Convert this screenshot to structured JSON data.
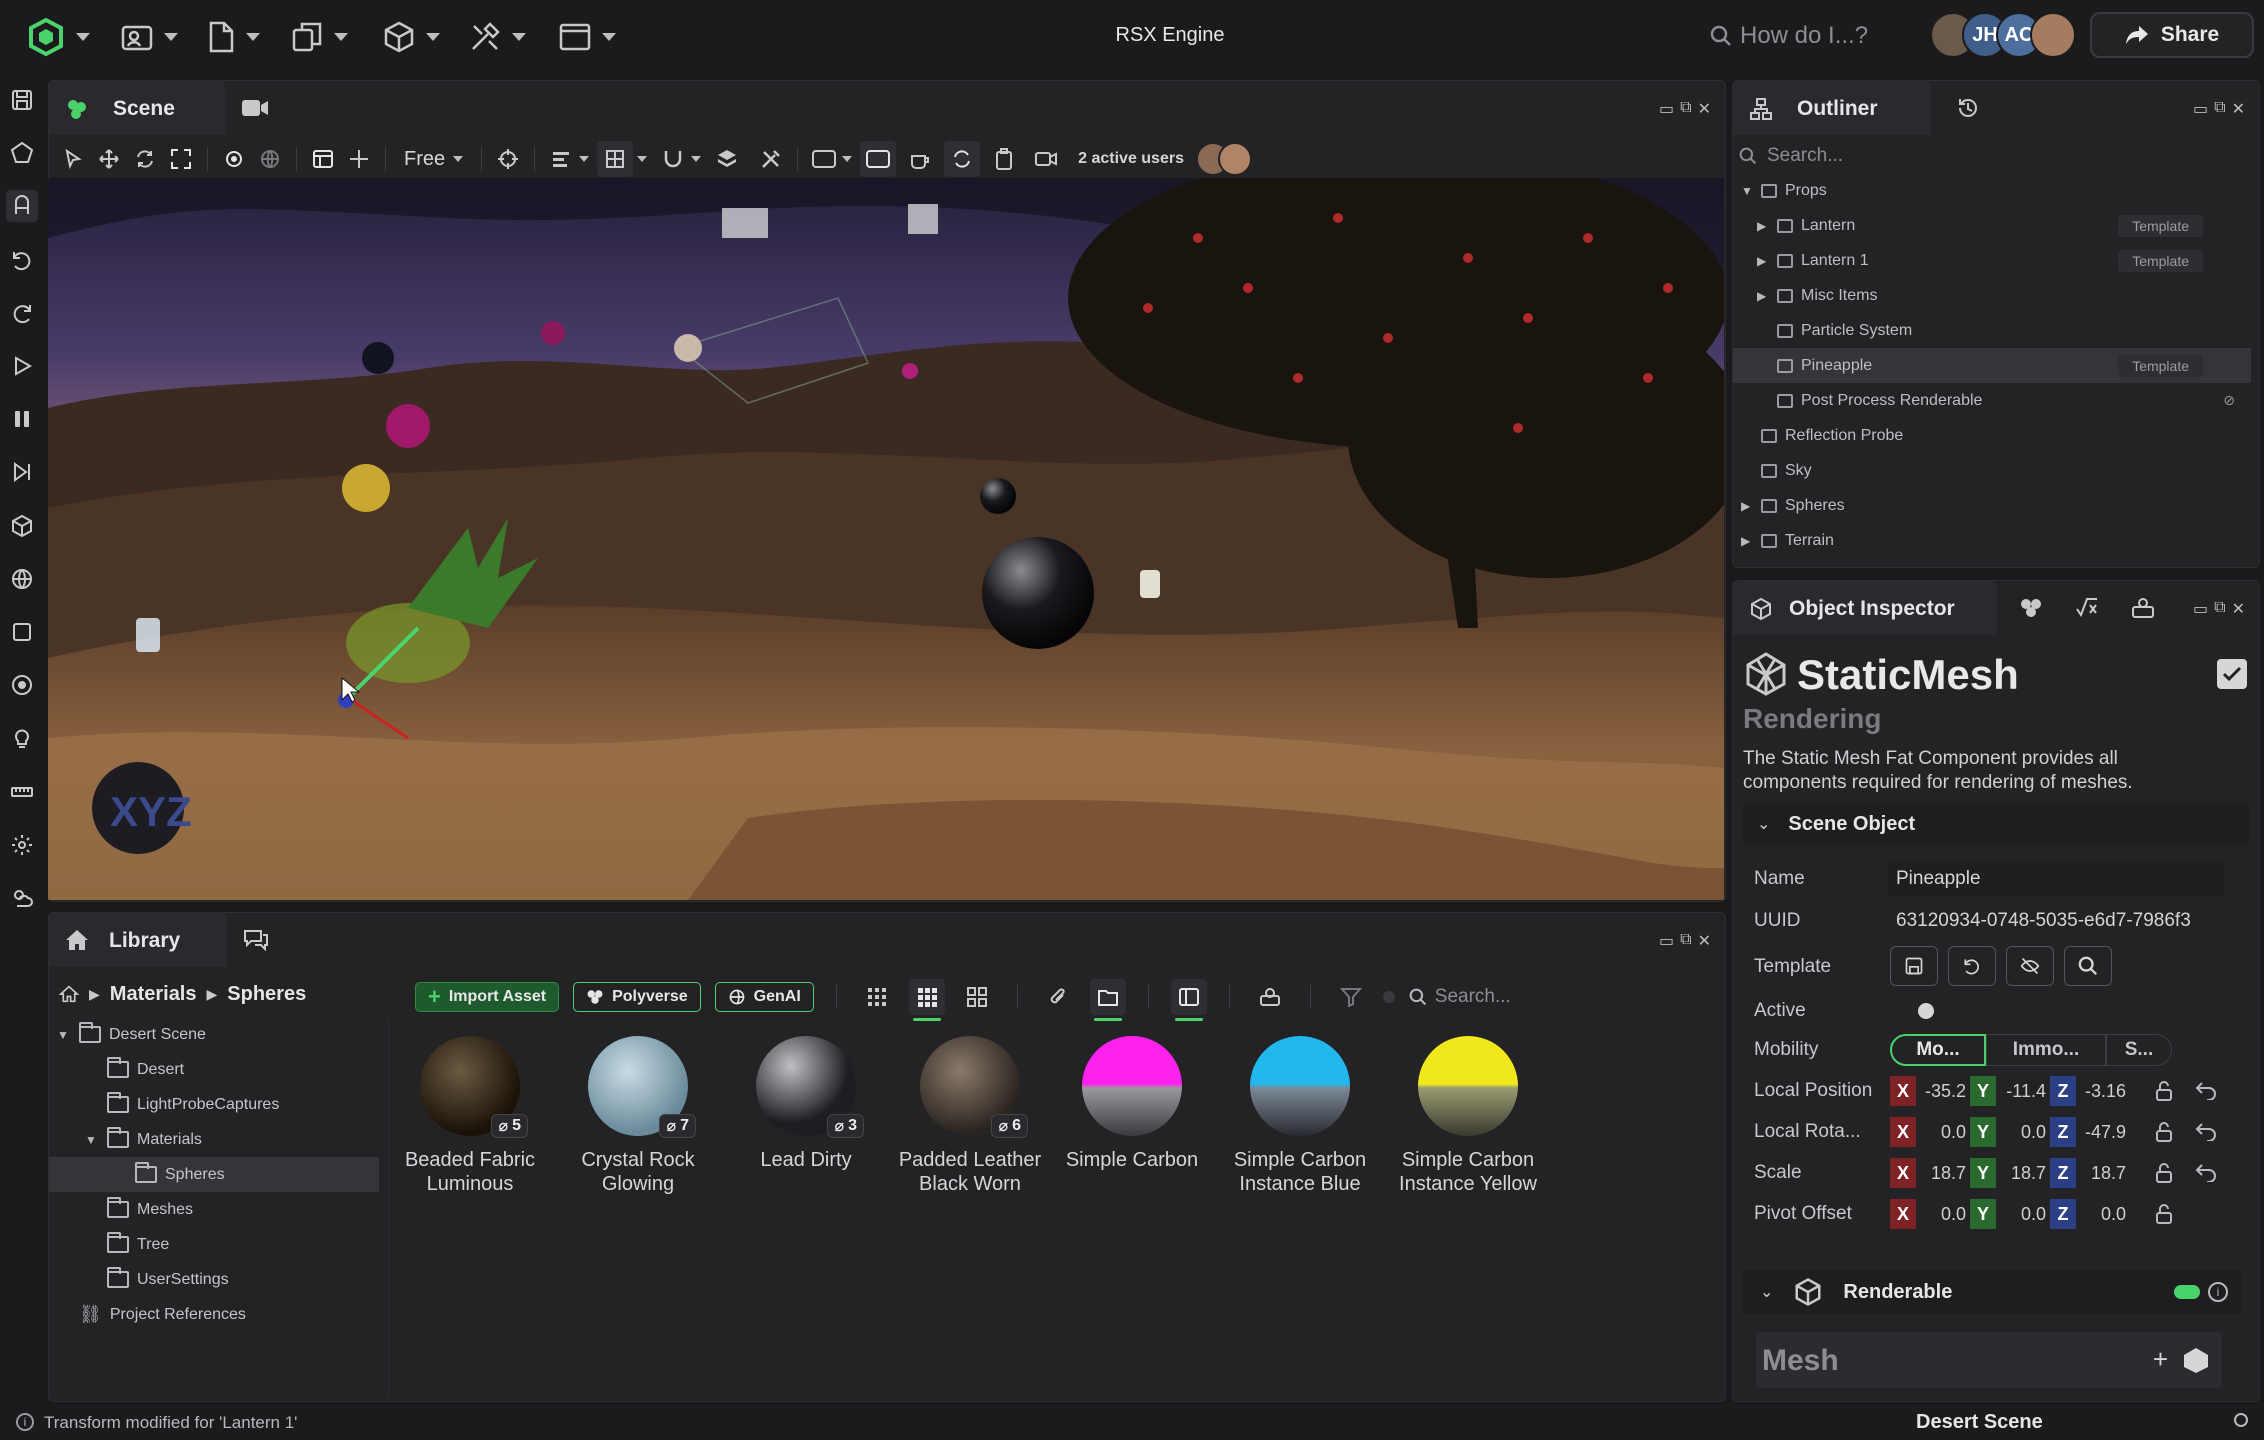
{
  "app": {
    "title": "RSX Engine"
  },
  "topbar": {
    "search_placeholder": "How do I...?",
    "share_label": "Share",
    "avatars": [
      {
        "initials": ""
      },
      {
        "initials": "JH"
      },
      {
        "initials": "AC"
      },
      {
        "initials": ""
      }
    ]
  },
  "scene": {
    "tab_title": "Scene",
    "camera_mode": "Free",
    "active_users": "2 active users"
  },
  "outliner": {
    "title": "Outliner",
    "search_placeholder": "Search...",
    "items": [
      {
        "label": "Props",
        "level": 0,
        "expanded": true
      },
      {
        "label": "Lantern",
        "level": 1,
        "badge": "Template"
      },
      {
        "label": "Lantern 1",
        "level": 1,
        "badge": "Template"
      },
      {
        "label": "Misc Items",
        "level": 1
      },
      {
        "label": "Particle System",
        "level": 1
      },
      {
        "label": "Pineapple",
        "level": 1,
        "badge": "Template",
        "selected": true
      },
      {
        "label": "Post Process Renderable",
        "level": 1
      },
      {
        "label": "Reflection Probe",
        "level": 0
      },
      {
        "label": "Sky",
        "level": 0
      },
      {
        "label": "Spheres",
        "level": 0
      },
      {
        "label": "Terrain",
        "level": 0
      }
    ]
  },
  "inspector": {
    "title": "Object Inspector",
    "component_name": "StaticMesh",
    "component_category": "Rendering",
    "description": "The Static Mesh Fat Component provides all components required for rendering of meshes.",
    "section_scene_object": "Scene Object",
    "name_label": "Name",
    "name_value": "Pineapple",
    "uuid_label": "UUID",
    "uuid_value": "63120934-0748-5035-e6d7-7986f3",
    "template_label": "Template",
    "active_label": "Active",
    "mobility_label": "Mobility",
    "mobility_options": [
      "Mo...",
      "Immo...",
      "S..."
    ],
    "local_position_label": "Local Position",
    "local_position": {
      "x": "-35.2",
      "y": "-11.4",
      "z": "-3.16"
    },
    "local_rotation_label": "Local Rota...",
    "local_rotation": {
      "x": "0.0",
      "y": "0.0",
      "z": "-47.9"
    },
    "scale_label": "Scale",
    "scale": {
      "x": "18.7",
      "y": "18.7",
      "z": "18.7"
    },
    "pivot_offset_label": "Pivot Offset",
    "pivot_offset": {
      "x": "0.0",
      "y": "0.0",
      "z": "0.0"
    },
    "section_renderable": "Renderable",
    "mesh_label": "Mesh"
  },
  "library": {
    "title": "Library",
    "breadcrumb": [
      "Materials",
      "Spheres"
    ],
    "import_label": "Import Asset",
    "polyverse_label": "Polyverse",
    "genai_label": "GenAI",
    "search_placeholder": "Search...",
    "tree": [
      {
        "label": "Desert Scene",
        "level": 0,
        "expanded": true
      },
      {
        "label": "Desert",
        "level": 1
      },
      {
        "label": "LightProbeCaptures",
        "level": 1
      },
      {
        "label": "Materials",
        "level": 1,
        "expanded": true
      },
      {
        "label": "Spheres",
        "level": 2,
        "selected": true
      },
      {
        "label": "Meshes",
        "level": 1
      },
      {
        "label": "Tree",
        "level": 1
      },
      {
        "label": "UserSettings",
        "level": 1
      },
      {
        "label": "Project References",
        "level": 0
      }
    ],
    "assets": [
      {
        "label": "Beaded Fabric Luminous",
        "count": "5"
      },
      {
        "label": "Crystal Rock Glowing",
        "count": "7"
      },
      {
        "label": "Lead Dirty",
        "count": "3"
      },
      {
        "label": "Padded Leather Black Worn",
        "count": "6"
      },
      {
        "label": "Simple Carbon",
        "count": ""
      },
      {
        "label": "Simple Carbon Instance Blue",
        "count": ""
      },
      {
        "label": "Simple Carbon Instance Yellow",
        "count": ""
      }
    ]
  },
  "status": {
    "message": "Transform modified for 'Lantern 1'",
    "scene_name": "Desert Scene"
  },
  "colors": {
    "accent": "#4bd36b",
    "panel": "#232326",
    "background": "#1a1a1c"
  }
}
